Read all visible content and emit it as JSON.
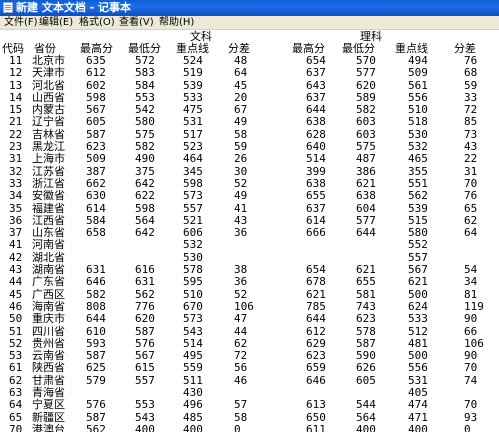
{
  "window": {
    "title": "新建 文本文档 - 记事本"
  },
  "menu": [
    "文件(F)",
    "编辑(E)",
    "格式(O)",
    "查看(V)",
    "帮助(H)"
  ],
  "groups": {
    "wenke": "文科",
    "like": "理科"
  },
  "columns": [
    "代码",
    "省份",
    "最高分",
    "最低分",
    "重点线",
    "分差",
    "最高分",
    "最低分",
    "重点线",
    "分差"
  ],
  "rows": [
    [
      "11",
      "北京市",
      "635",
      "572",
      "524",
      "48",
      "654",
      "570",
      "494",
      "76"
    ],
    [
      "12",
      "天津市",
      "612",
      "583",
      "519",
      "64",
      "637",
      "577",
      "509",
      "68"
    ],
    [
      "13",
      "河北省",
      "602",
      "584",
      "539",
      "45",
      "643",
      "620",
      "561",
      "59"
    ],
    [
      "14",
      "山西省",
      "598",
      "553",
      "533",
      "20",
      "637",
      "589",
      "556",
      "33"
    ],
    [
      "15",
      "内蒙古",
      "567",
      "542",
      "475",
      "67",
      "644",
      "582",
      "510",
      "72"
    ],
    [
      "21",
      "辽宁省",
      "605",
      "580",
      "531",
      "49",
      "638",
      "603",
      "518",
      "85"
    ],
    [
      "22",
      "吉林省",
      "587",
      "575",
      "517",
      "58",
      "628",
      "603",
      "530",
      "73"
    ],
    [
      "23",
      "黑龙江",
      "623",
      "582",
      "523",
      "59",
      "640",
      "575",
      "532",
      "43"
    ],
    [
      "31",
      "上海市",
      "509",
      "490",
      "464",
      "26",
      "514",
      "487",
      "465",
      "22"
    ],
    [
      "32",
      "江苏省",
      "387",
      "375",
      "345",
      "30",
      "399",
      "386",
      "355",
      "31"
    ],
    [
      "33",
      "浙江省",
      "662",
      "642",
      "598",
      "52",
      "638",
      "621",
      "551",
      "70"
    ],
    [
      "34",
      "安徽省",
      "630",
      "622",
      "573",
      "49",
      "655",
      "638",
      "562",
      "76"
    ],
    [
      "35",
      "福建省",
      "614",
      "598",
      "557",
      "41",
      "637",
      "604",
      "539",
      "65"
    ],
    [
      "36",
      "江西省",
      "584",
      "564",
      "521",
      "43",
      "614",
      "577",
      "515",
      "62"
    ],
    [
      "37",
      "山东省",
      "658",
      "642",
      "606",
      "36",
      "666",
      "644",
      "580",
      "64"
    ],
    [
      "41",
      "河南省",
      "",
      "",
      "532",
      "",
      "",
      "",
      "552",
      ""
    ],
    [
      "42",
      "湖北省",
      "",
      "",
      "530",
      "",
      "",
      "",
      "557",
      ""
    ],
    [
      "43",
      "湖南省",
      "631",
      "616",
      "578",
      "38",
      "654",
      "621",
      "567",
      "54"
    ],
    [
      "44",
      "广东省",
      "646",
      "631",
      "595",
      "36",
      "678",
      "655",
      "621",
      "34"
    ],
    [
      "45",
      "广西区",
      "582",
      "562",
      "510",
      "52",
      "621",
      "581",
      "500",
      "81"
    ],
    [
      "46",
      "海南省",
      "808",
      "776",
      "670",
      "106",
      "785",
      "743",
      "624",
      "119"
    ],
    [
      "50",
      "重庆市",
      "644",
      "620",
      "573",
      "47",
      "644",
      "623",
      "533",
      "90"
    ],
    [
      "51",
      "四川省",
      "610",
      "587",
      "543",
      "44",
      "612",
      "578",
      "512",
      "66"
    ],
    [
      "52",
      "贵州省",
      "593",
      "576",
      "514",
      "62",
      "629",
      "587",
      "481",
      "106"
    ],
    [
      "53",
      "云南省",
      "587",
      "567",
      "495",
      "72",
      "623",
      "590",
      "500",
      "90"
    ],
    [
      "61",
      "陕西省",
      "625",
      "615",
      "559",
      "56",
      "659",
      "626",
      "556",
      "70"
    ],
    [
      "62",
      "甘肃省",
      "579",
      "557",
      "511",
      "46",
      "646",
      "605",
      "531",
      "74"
    ],
    [
      "63",
      "青海省",
      "",
      "",
      "430",
      "",
      "",
      "",
      "405",
      ""
    ],
    [
      "64",
      "宁夏区",
      "576",
      "553",
      "496",
      "57",
      "613",
      "544",
      "474",
      "70"
    ],
    [
      "65",
      "新疆区",
      "587",
      "543",
      "485",
      "58",
      "650",
      "564",
      "471",
      "93"
    ],
    [
      "70",
      "港澳台",
      "562",
      "400",
      "400",
      "0",
      "611",
      "400",
      "400",
      "0"
    ]
  ]
}
